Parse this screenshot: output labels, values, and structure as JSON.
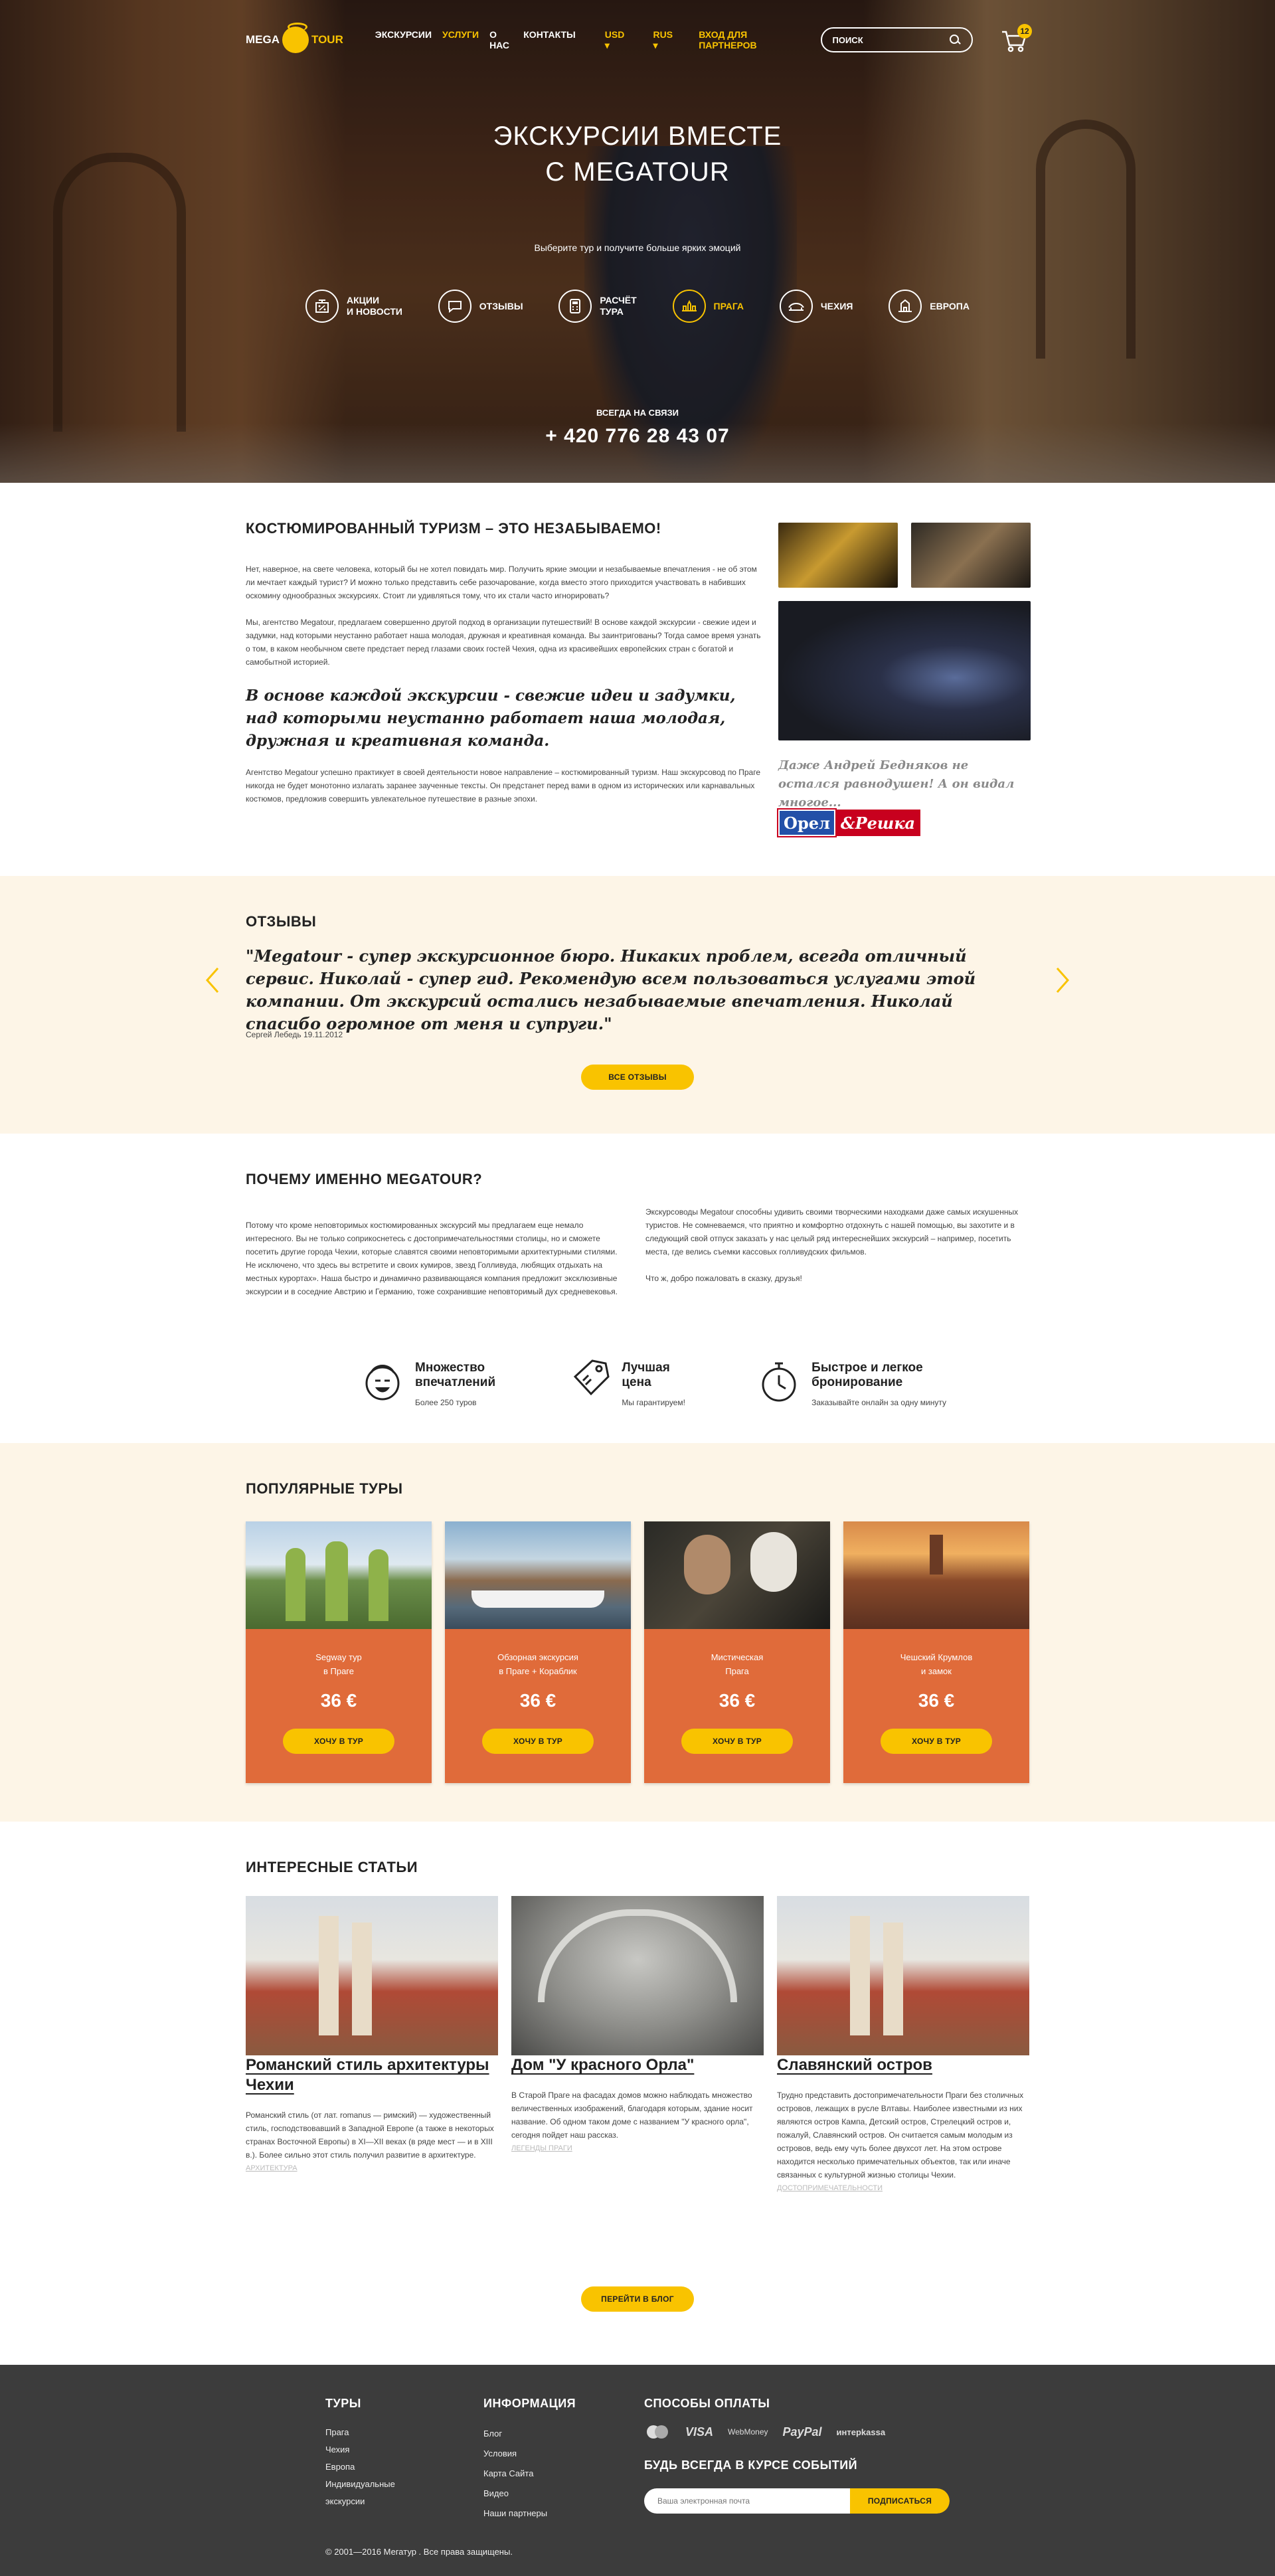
{
  "nav": {
    "logo_a": "MEGA",
    "logo_b": "TOUR",
    "items": [
      "ЭКСКУРСИИ",
      "УСЛУГИ",
      "О НАС",
      "КОНТАКТЫ"
    ],
    "currency": "USD",
    "language": "RUS",
    "partner_login": "ВХОД ДЛЯ ПАРТНЕРОВ",
    "search_placeholder": "ПОИСК",
    "cart_count": "12"
  },
  "hero": {
    "title_line1": "ЭКСКУРСИИ ВМЕСТЕ",
    "title_line2": "С MEGATOUR",
    "subtitle": "Выберите тур и получите больше ярких эмоций",
    "icons": [
      {
        "l1": "АКЦИИ",
        "l2": "И НОВОСТИ",
        "icon": "percent-icon"
      },
      {
        "l1": "ОТЗЫВЫ",
        "l2": "",
        "icon": "reviews-icon"
      },
      {
        "l1": "РАСЧЁТ",
        "l2": "ТУРА",
        "icon": "calculator-icon"
      },
      {
        "l1": "ПРАГА",
        "l2": "",
        "icon": "prague-icon"
      },
      {
        "l1": "ЧЕХИЯ",
        "l2": "",
        "icon": "czech-icon"
      },
      {
        "l1": "ЕВРОПА",
        "l2": "",
        "icon": "europe-icon"
      }
    ],
    "contact_label": "ВСЕГДА НА СВЯЗИ",
    "phone": "+ 420 776 28 43 07"
  },
  "intro": {
    "title": "КОСТЮМИРОВАННЫЙ ТУРИЗМ – ЭТО НЕЗАБЫВАЕМО!",
    "p1": "Нет, наверное, на свете человека, который бы не хотел повидать мир. Получить яркие эмоции и незабываемые впечатления - не об этом ли мечтает каждый турист? И можно только представить себе разочарование, когда вместо этого приходится участвовать в набивших оскомину однообразных экскурсиях. Стоит ли удивляться тому, что их стали часто игнорировать?",
    "p2": "Мы, агентство Megatour, предлагаем совершенно другой подход в организации путешествий! В основе каждой экскурсии - свежие идеи и задумки, над которыми неустанно работает наша молодая, дружная и креативная команда. Вы заинтригованы? Тогда самое время узнать о том, в каком необычном свете предстает перед глазами своих гостей Чехия, одна из красивейших европейских стран с богатой и самобытной историей.",
    "quote": "В основе каждой экскурсии - свежие идеи и задумки, над которыми неустанно работает наша молодая, дружная и креативная команда.",
    "p3": "Агентство Megatour успешно практикует в своей деятельности новое направление – костюмированный туризм. Наш экскурсовод по Праге никогда не будет монотонно излагать заранее заученные тексты. Он предстанет перед вами в одном из исторических или карнавальных костюмов, предложив совершить увлекательное путешествие в разные эпохи.",
    "side_quote": "Даже Андрей Бедняков не остался равнодушен! А он видал многое...",
    "badge_a": "Орел",
    "badge_b": "&Решка"
  },
  "reviews": {
    "title": "ОТЗЫВЫ",
    "text": "\"Megatour - супер экскурсионное бюро. Никаких проблем, всегда отличный сервис. Николай - супер гид. Рекомендую всем пользоваться услугами этой компании. От экскурсий остались незабываемые впечатления. Николай спасибо огромное от меня и супруги.\"",
    "author": "Сергей Лебедь 19.11.2012",
    "button": "ВСЕ ОТЗЫВЫ"
  },
  "why": {
    "title": "ПОЧЕМУ ИМЕННО MEGATOUR?",
    "left": "Потому что кроме неповторимых костюмированных экскурсий мы предлагаем еще немало интересного. Вы не только соприкоснетесь с достопримечательностями столицы, но и сможете посетить другие города Чехии, которые славятся своими неповторимыми архитектурными стилями. Не исключено, что здесь вы встретите и своих кумиров, звезд Голливуда, любящих отдыхать на местных курортах». Наша быстро и динамично развивающаяся компания предложит эксклюзивные экскурсии и в соседние Австрию и Германию, тоже сохранившие неповторимый дух средневековья.",
    "right1": "Экскурсоводы Megatour способны удивить своими творческими находками даже самых искушенных туристов. Не сомневаемся, что приятно и комфортно отдохнуть с нашей помощью, вы захотите и в следующий свой отпуск заказать у нас целый ряд интереснейших экскурсий – например, посетить места, где велись съемки кассовых голливудских фильмов.",
    "right2": "Что ж, добро пожаловать в сказку, друзья!",
    "features": [
      {
        "t1": "Множество",
        "t2": "впечатлений",
        "sub": "Более 250 туров"
      },
      {
        "t1": "Лучшая",
        "t2": "цена",
        "sub": "Мы гарантируем!"
      },
      {
        "t1": "Быстрое и легкое",
        "t2": "бронирование",
        "sub": "Заказывайте онлайн за одну минуту"
      }
    ]
  },
  "tours": {
    "title": "ПОПУЛЯРНЫЕ ТУРЫ",
    "items": [
      {
        "n1": "Segway тур",
        "n2": "в Праге",
        "price": "36 €",
        "button": "ХОЧУ В ТУР"
      },
      {
        "n1": "Обзорная экскурсия",
        "n2": "в Праге + Кораблик",
        "price": "36 €",
        "button": "ХОЧУ В ТУР"
      },
      {
        "n1": "Мистическая",
        "n2": "Прага",
        "price": "36 €",
        "button": "ХОЧУ В ТУР"
      },
      {
        "n1": "Чешский Крумлов",
        "n2": "и замок",
        "price": "36 €",
        "button": "ХОЧУ В ТУР"
      }
    ]
  },
  "articles": {
    "title": "ИНТЕРЕСНЫЕ СТАТЬИ",
    "items": [
      {
        "title": "Романский стиль архитектуры Чехии",
        "text": "Романский стиль (от лат. romanus — римский) — художественный стиль, господствовавший в Западной Европе (а также в некоторых странах Восточной Европы) в XI—XII веках (в ряде мест — и в XIII в.). Более сильно этот стиль получил развитие в архитектуре.",
        "tag": "АРХИТЕКТУРА"
      },
      {
        "title": "Дом \"У красного Орла\"",
        "text": "В Старой Праге на фасадах домов можно наблюдать множество величественных изображений, благодаря которым, здание носит название. Об одном таком доме с названием \"У красного орла\", сегодня пойдет наш рассказ.",
        "tag": "ЛЕГЕНДЫ ПРАГИ"
      },
      {
        "title": "Славянский остров",
        "text": "Трудно представить достопримечательности Праги без столичных островов, лежащих в русле Влтавы. Наиболее известными из них являются остров Кампа, Детский остров, Стрелецкий остров и, пожалуй, Славянский остров. Он считается самым молодым из островов, ведь ему чуть более двухсот лет. На этом острове находится несколько примечательных объектов, так или иначе связанных с культурной жизнью столицы Чехии.",
        "tag": "ДОСТОПРИМЕЧАТЕЛЬНОСТИ"
      }
    ],
    "button": "ПЕРЕЙТИ В БЛОГ"
  },
  "footer": {
    "col1_title": "ТУРЫ",
    "col1": [
      "Прага",
      "Чехия",
      "Европа",
      "Индивидуальные",
      "экскурсии"
    ],
    "col2_title": "ИНФОРМАЦИЯ",
    "col2": [
      "Блог",
      "Условия",
      "Карта Сайта",
      "Видео",
      "Наши партнеры"
    ],
    "pay_title": "СПОСОБЫ ОПЛАТЫ",
    "pay": [
      "VISA",
      "WebMoney",
      "PayPal",
      "интерkassa"
    ],
    "news_title": "БУДЬ ВСЕГДА В КУРСЕ СОБЫТИЙ",
    "email_placeholder": "Ваша электронная почта",
    "subscribe": "ПОДПИСАТЬСЯ",
    "copyright": "© 2001—2016 Мегатур . Все права защищены."
  },
  "colors": {
    "accent": "#f9c300",
    "card": "#e06b3a",
    "cream": "#fdf5e7",
    "footer": "#3c3c3c"
  }
}
